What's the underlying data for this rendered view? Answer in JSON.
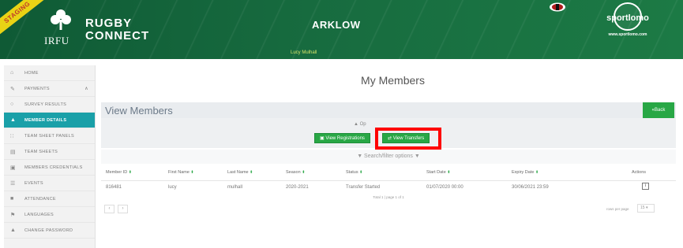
{
  "header": {
    "staging_label": "STAGING",
    "irfu_label": "IRFU",
    "brand_line1": "RUGBY",
    "brand_line2": "CONNECT",
    "club_name": "ARKLOW",
    "user_name": "Lucy Mulhall",
    "sportlomo_name": "sportlomo",
    "sportlomo_url": "www.sportlomo.com"
  },
  "sidebar": {
    "items": [
      {
        "label": "HOME",
        "icon": "home-icon"
      },
      {
        "label": "PAYMENTS",
        "icon": "edit-icon"
      },
      {
        "label": "SURVEY RESULTS",
        "icon": "circle-icon"
      },
      {
        "label": "MEMBER DETAILS",
        "icon": "user-icon"
      },
      {
        "label": "TEAM SHEET PANELS",
        "icon": "group-icon"
      },
      {
        "label": "TEAM SHEETS",
        "icon": "file-icon"
      },
      {
        "label": "MEMBERS CREDENTIALS",
        "icon": "id-card-icon"
      },
      {
        "label": "EVENTS",
        "icon": "list-icon"
      },
      {
        "label": "ATTENDANCE",
        "icon": "clipboard-icon"
      },
      {
        "label": "LANGUAGES",
        "icon": "flag-icon"
      },
      {
        "label": "CHANGE PASSWORD",
        "icon": "user-lock-icon"
      }
    ],
    "active_index": 3
  },
  "main": {
    "page_title": "My Members",
    "panel_title": "View Members",
    "back_label": "«Back",
    "options_label": "▲  Op",
    "view_registrations_label": "View Registrations",
    "view_transfers_label": "View Transfers",
    "filter_label": "▼  Search/filter options  ▼"
  },
  "table": {
    "columns": [
      "Member ID",
      "First Name",
      "Last Name",
      "Season",
      "Status",
      "Start Date",
      "Expiry Date",
      "Actions"
    ],
    "rows": [
      [
        "816481",
        "lucy",
        "mulhall",
        "2020-2021",
        "Transfer Started",
        "01/07/2020 00:00",
        "30/06/2021 23:59",
        ""
      ]
    ],
    "total_text": "Total 1   |   page 1 of 1",
    "rows_per_page_label": "rows per page",
    "rows_per_page_value": "15"
  },
  "colors": {
    "header_green": "#176b3f",
    "accent_teal": "#1aa0a8",
    "button_green": "#28a745",
    "highlight_red": "#ff0000"
  }
}
